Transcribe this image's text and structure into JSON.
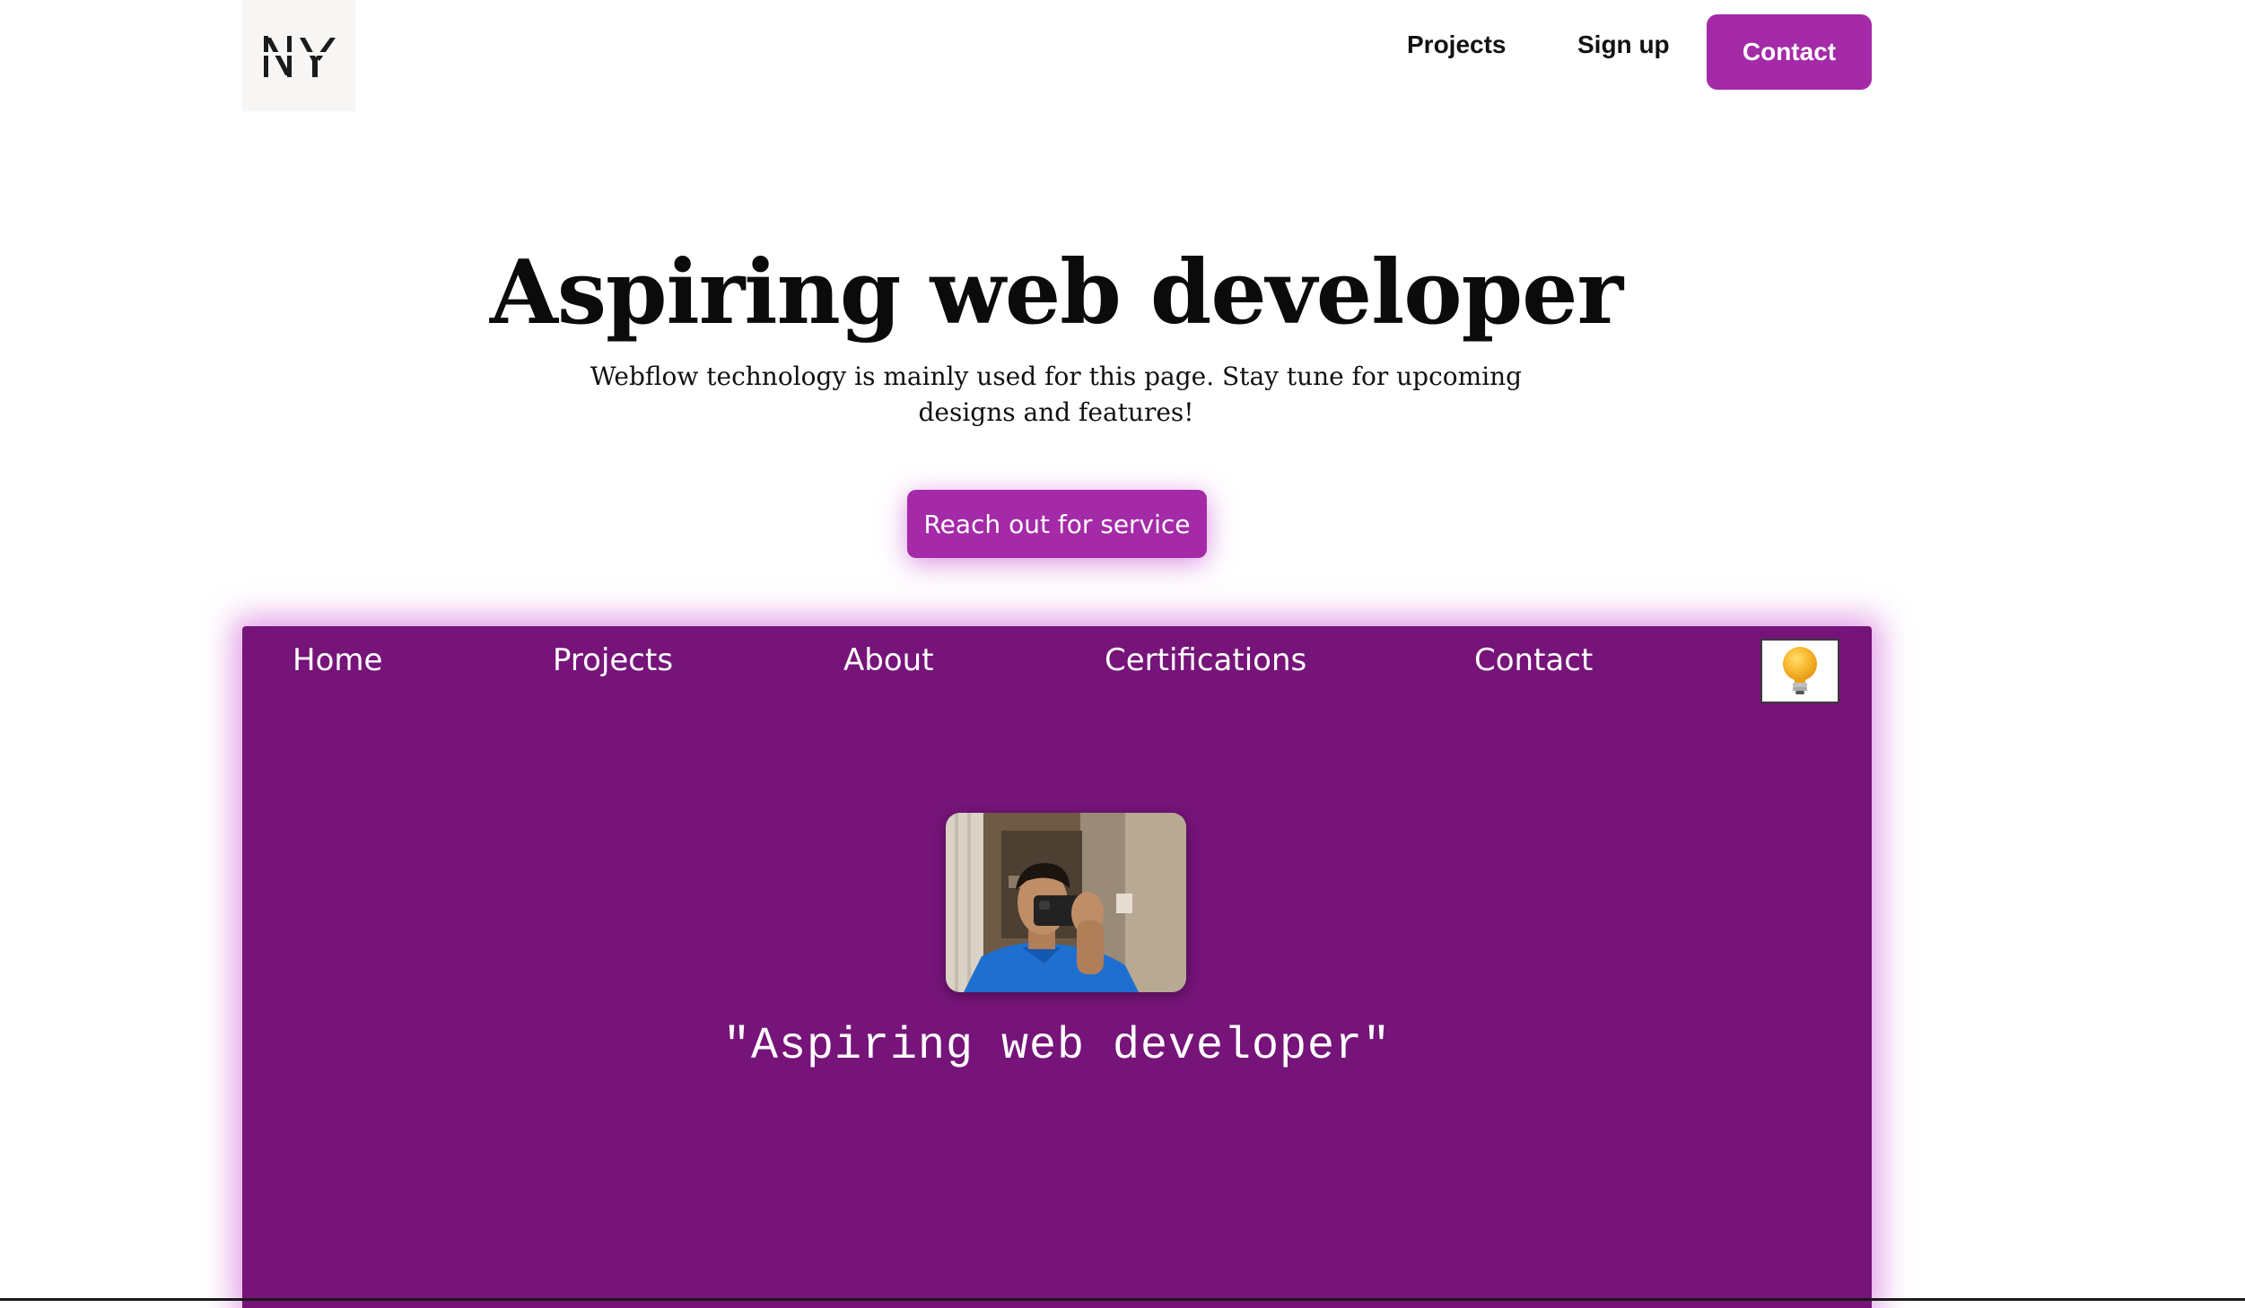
{
  "brand": {
    "logo_text": "NY",
    "accent_color": "#a42aa8",
    "panel_color": "#761479"
  },
  "topnav": {
    "links": [
      {
        "label": "Projects"
      },
      {
        "label": "Sign up"
      }
    ],
    "contact_label": "Contact"
  },
  "hero": {
    "title": "Aspiring web developer",
    "subtitle": "Webflow technology is mainly used for this page. Stay tune for upcoming designs and features!",
    "cta_label": "Reach out for service"
  },
  "panel": {
    "nav": [
      {
        "label": "Home"
      },
      {
        "label": "Projects"
      },
      {
        "label": "About"
      },
      {
        "label": "Certifications"
      },
      {
        "label": "Contact"
      }
    ],
    "theme_toggle_icon": "lightbulb-icon",
    "profile_photo": "profile-photo",
    "quote": "\"Aspiring web developer\""
  }
}
